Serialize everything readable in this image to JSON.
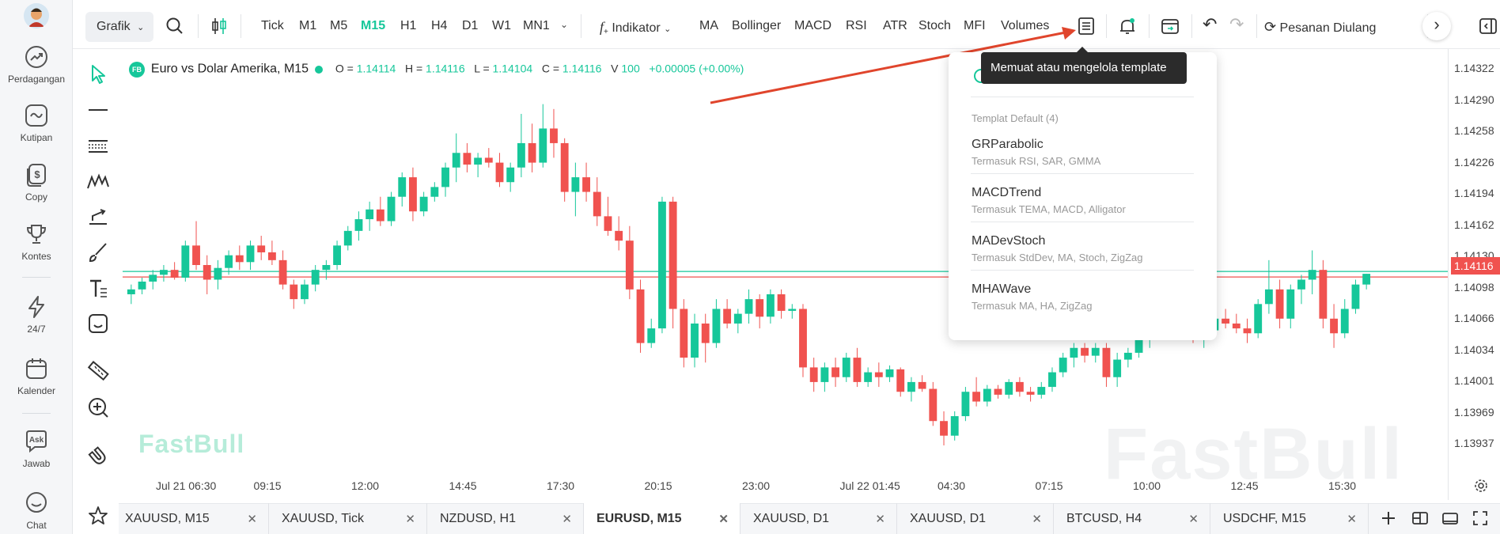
{
  "nav": {
    "items": [
      {
        "label": "Perdagangan",
        "icon": "trending-up-icon"
      },
      {
        "label": "Kutipan",
        "icon": "chart-quote-icon"
      },
      {
        "label": "Copy",
        "icon": "dollar-copy-icon"
      },
      {
        "label": "Kontes",
        "icon": "trophy-icon"
      },
      {
        "label": "24/7",
        "icon": "lightning-icon"
      },
      {
        "label": "Kalender",
        "icon": "calendar-icon"
      },
      {
        "label": "Jawab",
        "icon": "ask-icon"
      },
      {
        "label": "Chat",
        "icon": "chat-icon"
      }
    ],
    "ask_badge": "Ask"
  },
  "toolbar": {
    "grafik": "Grafik",
    "timeframes": [
      "Tick",
      "M1",
      "M5",
      "M15",
      "H1",
      "H4",
      "D1",
      "W1",
      "MN1"
    ],
    "active_timeframe": "M15",
    "indikator": "Indikator",
    "indicators": [
      "MA",
      "Bollinger",
      "MACD",
      "RSI",
      "ATR",
      "Stoch",
      "MFI",
      "Volumes"
    ],
    "repeat_order": "Pesanan Diulang",
    "accent": "#16c79a"
  },
  "legend": {
    "badge": "FB",
    "symbol": "Euro vs Dolar Amerika, M15",
    "o_label": "O =",
    "o": "1.14114",
    "h_label": "H =",
    "h": "1.14116",
    "l_label": "L =",
    "l": "1.14104",
    "c_label": "C =",
    "c": "1.14116",
    "v_label": "V",
    "v": "100",
    "change": "+0.00005 (+0.00%)"
  },
  "price_axis": {
    "labels": [
      "1.14322",
      "1.14290",
      "1.14258",
      "1.14226",
      "1.14194",
      "1.14162",
      "1.14130",
      "1.14098",
      "1.14066",
      "1.14034",
      "1.14001",
      "1.13969",
      "1.13937"
    ],
    "current": "1.14116",
    "up_color": "#16c79a",
    "down_color": "#f0524f"
  },
  "time_axis": [
    "Jul 21 06:30",
    "09:15",
    "12:00",
    "14:45",
    "17:30",
    "20:15",
    "23:00",
    "Jul 22 01:45",
    "04:30",
    "07:15",
    "10:00",
    "12:45",
    "15:30"
  ],
  "watermark": "FastBull",
  "tooltip": "Memuat atau mengelola template",
  "templates": {
    "header": "Templat Default (4)",
    "items": [
      {
        "name": "GRParabolic",
        "desc": "Termasuk RSI, SAR, GMMA"
      },
      {
        "name": "MACDTrend",
        "desc": "Termasuk TEMA, MACD, Alligator"
      },
      {
        "name": "MADevStoch",
        "desc": "Termasuk StdDev, MA, Stoch, ZigZag"
      },
      {
        "name": "MHAWave",
        "desc": "Termasuk MA, HA, ZigZag"
      }
    ]
  },
  "symbol_tabs": [
    {
      "label": "XAUUSD, M15",
      "active": false
    },
    {
      "label": "XAUUSD, Tick",
      "active": false
    },
    {
      "label": "NZDUSD, H1",
      "active": false
    },
    {
      "label": "EURUSD, M15",
      "active": true
    },
    {
      "label": "XAUUSD, D1",
      "active": false
    },
    {
      "label": "XAUUSD, D1",
      "active": false
    },
    {
      "label": "BTCUSD, H4",
      "active": false
    },
    {
      "label": "USDCHF, M15",
      "active": false
    }
  ],
  "chart_data": {
    "type": "candlestick",
    "symbol": "Euro vs Dolar Amerika, M15",
    "ylim": [
      1.1391,
      1.1434
    ],
    "current_price": 1.14116,
    "ohlc": [
      [
        1.14095,
        1.14105,
        1.14085,
        1.141
      ],
      [
        1.141,
        1.14112,
        1.14095,
        1.14108
      ],
      [
        1.14108,
        1.1412,
        1.141,
        1.14115
      ],
      [
        1.14115,
        1.14125,
        1.14108,
        1.1412
      ],
      [
        1.1412,
        1.14128,
        1.1411,
        1.14112
      ],
      [
        1.14112,
        1.1415,
        1.14108,
        1.14145
      ],
      [
        1.14145,
        1.1417,
        1.1412,
        1.14125
      ],
      [
        1.14125,
        1.14135,
        1.14095,
        1.1411
      ],
      [
        1.1411,
        1.1413,
        1.141,
        1.14122
      ],
      [
        1.14122,
        1.1414,
        1.14115,
        1.14135
      ],
      [
        1.14135,
        1.14145,
        1.1412,
        1.14128
      ],
      [
        1.14128,
        1.1415,
        1.1412,
        1.14145
      ],
      [
        1.14145,
        1.14155,
        1.1413,
        1.14138
      ],
      [
        1.14138,
        1.1415,
        1.14125,
        1.1413
      ],
      [
        1.1413,
        1.1414,
        1.141,
        1.14105
      ],
      [
        1.14105,
        1.1411,
        1.1408,
        1.1409
      ],
      [
        1.1409,
        1.1411,
        1.14085,
        1.14105
      ],
      [
        1.14105,
        1.14125,
        1.14098,
        1.1412
      ],
      [
        1.1412,
        1.1413,
        1.1411,
        1.14125
      ],
      [
        1.14125,
        1.1415,
        1.1412,
        1.14145
      ],
      [
        1.14145,
        1.14165,
        1.1414,
        1.1416
      ],
      [
        1.1416,
        1.1418,
        1.1415,
        1.14172
      ],
      [
        1.14172,
        1.1419,
        1.1416,
        1.14182
      ],
      [
        1.14182,
        1.14195,
        1.14165,
        1.1417
      ],
      [
        1.1417,
        1.142,
        1.14165,
        1.14195
      ],
      [
        1.14195,
        1.1422,
        1.14185,
        1.14215
      ],
      [
        1.14215,
        1.14225,
        1.1417,
        1.1418
      ],
      [
        1.1418,
        1.142,
        1.14175,
        1.14195
      ],
      [
        1.14195,
        1.1421,
        1.1419,
        1.14205
      ],
      [
        1.14205,
        1.1423,
        1.14195,
        1.14225
      ],
      [
        1.14225,
        1.1426,
        1.1421,
        1.1424
      ],
      [
        1.1424,
        1.1425,
        1.1422,
        1.14228
      ],
      [
        1.14228,
        1.1424,
        1.14215,
        1.14235
      ],
      [
        1.14235,
        1.14245,
        1.14225,
        1.1423
      ],
      [
        1.1423,
        1.1424,
        1.14205,
        1.1421
      ],
      [
        1.1421,
        1.1423,
        1.142,
        1.14225
      ],
      [
        1.14225,
        1.1428,
        1.14215,
        1.1425
      ],
      [
        1.1425,
        1.1427,
        1.1422,
        1.1423
      ],
      [
        1.1423,
        1.1429,
        1.14225,
        1.14265
      ],
      [
        1.14265,
        1.14285,
        1.14235,
        1.1425
      ],
      [
        1.1425,
        1.14255,
        1.1419,
        1.142
      ],
      [
        1.142,
        1.1423,
        1.14175,
        1.14215
      ],
      [
        1.14215,
        1.1423,
        1.1419,
        1.142
      ],
      [
        1.142,
        1.14215,
        1.14165,
        1.14175
      ],
      [
        1.14175,
        1.14195,
        1.14155,
        1.1416
      ],
      [
        1.1416,
        1.14175,
        1.1414,
        1.1415
      ],
      [
        1.1415,
        1.14165,
        1.1409,
        1.141
      ],
      [
        1.141,
        1.1411,
        1.14035,
        1.14045
      ],
      [
        1.14045,
        1.1407,
        1.1404,
        1.1406
      ],
      [
        1.1406,
        1.14195,
        1.14055,
        1.1419
      ],
      [
        1.1419,
        1.14195,
        1.1406,
        1.1408
      ],
      [
        1.1408,
        1.1409,
        1.1402,
        1.1403
      ],
      [
        1.1403,
        1.14075,
        1.1402,
        1.14065
      ],
      [
        1.14065,
        1.14075,
        1.14025,
        1.14045
      ],
      [
        1.14045,
        1.1409,
        1.1404,
        1.1408
      ],
      [
        1.1408,
        1.1409,
        1.1406,
        1.14065
      ],
      [
        1.14065,
        1.1408,
        1.14055,
        1.14075
      ],
      [
        1.14075,
        1.141,
        1.14065,
        1.1409
      ],
      [
        1.1409,
        1.14095,
        1.1406,
        1.14072
      ],
      [
        1.14072,
        1.141,
        1.14065,
        1.14095
      ],
      [
        1.14095,
        1.141,
        1.1407,
        1.14078
      ],
      [
        1.14078,
        1.14085,
        1.1407,
        1.1408
      ],
      [
        1.1408,
        1.14085,
        1.1401,
        1.1402
      ],
      [
        1.1402,
        1.1403,
        1.13995,
        1.14005
      ],
      [
        1.14005,
        1.14025,
        1.13995,
        1.1402
      ],
      [
        1.1402,
        1.1403,
        1.14,
        1.1401
      ],
      [
        1.1401,
        1.14035,
        1.14005,
        1.1403
      ],
      [
        1.1403,
        1.1404,
        1.14,
        1.14005
      ],
      [
        1.14005,
        1.1402,
        1.14,
        1.14015
      ],
      [
        1.14015,
        1.14025,
        1.14,
        1.1401
      ],
      [
        1.1401,
        1.14022,
        1.14005,
        1.14018
      ],
      [
        1.14018,
        1.1402,
        1.1399,
        1.13995
      ],
      [
        1.13995,
        1.1401,
        1.13985,
        1.14005
      ],
      [
        1.14005,
        1.14012,
        1.13995,
        1.13998
      ],
      [
        1.13998,
        1.14005,
        1.1396,
        1.13965
      ],
      [
        1.13965,
        1.13975,
        1.1394,
        1.1395
      ],
      [
        1.1395,
        1.13975,
        1.13945,
        1.1397
      ],
      [
        1.1397,
        1.14,
        1.13965,
        1.13995
      ],
      [
        1.13995,
        1.1401,
        1.1398,
        1.13985
      ],
      [
        1.13985,
        1.14002,
        1.1398,
        1.13998
      ],
      [
        1.13998,
        1.14002,
        1.13988,
        1.13992
      ],
      [
        1.13992,
        1.14008,
        1.13988,
        1.14005
      ],
      [
        1.14005,
        1.1401,
        1.1399,
        1.13995
      ],
      [
        1.13995,
        1.14,
        1.13985,
        1.13992
      ],
      [
        1.13992,
        1.14005,
        1.13988,
        1.14
      ],
      [
        1.14,
        1.1402,
        1.13995,
        1.14015
      ],
      [
        1.14015,
        1.14035,
        1.1401,
        1.1403
      ],
      [
        1.1403,
        1.14045,
        1.1402,
        1.1404
      ],
      [
        1.1404,
        1.14045,
        1.14025,
        1.14032
      ],
      [
        1.14032,
        1.14045,
        1.14025,
        1.1404
      ],
      [
        1.1404,
        1.14045,
        1.14,
        1.1401
      ],
      [
        1.1401,
        1.14035,
        1.14,
        1.14028
      ],
      [
        1.14028,
        1.1404,
        1.1402,
        1.14035
      ],
      [
        1.14035,
        1.1406,
        1.1403,
        1.14055
      ],
      [
        1.14055,
        1.14065,
        1.1404,
        1.1406
      ],
      [
        1.1406,
        1.1407,
        1.1405,
        1.14058
      ],
      [
        1.14058,
        1.1407,
        1.1405,
        1.14065
      ],
      [
        1.14065,
        1.14075,
        1.14055,
        1.14062
      ],
      [
        1.14062,
        1.1407,
        1.14045,
        1.1405
      ],
      [
        1.1405,
        1.1406,
        1.1404,
        1.14058
      ],
      [
        1.14058,
        1.14075,
        1.1405,
        1.1407
      ],
      [
        1.1407,
        1.1408,
        1.1406,
        1.14065
      ],
      [
        1.14065,
        1.14075,
        1.14055,
        1.1406
      ],
      [
        1.1406,
        1.1407,
        1.14045,
        1.14055
      ],
      [
        1.14055,
        1.1409,
        1.1405,
        1.14085
      ],
      [
        1.14085,
        1.1413,
        1.14075,
        1.141
      ],
      [
        1.141,
        1.1411,
        1.1406,
        1.1407
      ],
      [
        1.1407,
        1.14105,
        1.1406,
        1.141
      ],
      [
        1.141,
        1.14115,
        1.14085,
        1.1411
      ],
      [
        1.1411,
        1.1414,
        1.14095,
        1.1412
      ],
      [
        1.1412,
        1.1413,
        1.1406,
        1.1407
      ],
      [
        1.1407,
        1.14085,
        1.1404,
        1.14055
      ],
      [
        1.14055,
        1.1409,
        1.1405,
        1.1408
      ],
      [
        1.1408,
        1.1411,
        1.14075,
        1.14105
      ],
      [
        1.14105,
        1.14116,
        1.141,
        1.14116
      ]
    ]
  }
}
